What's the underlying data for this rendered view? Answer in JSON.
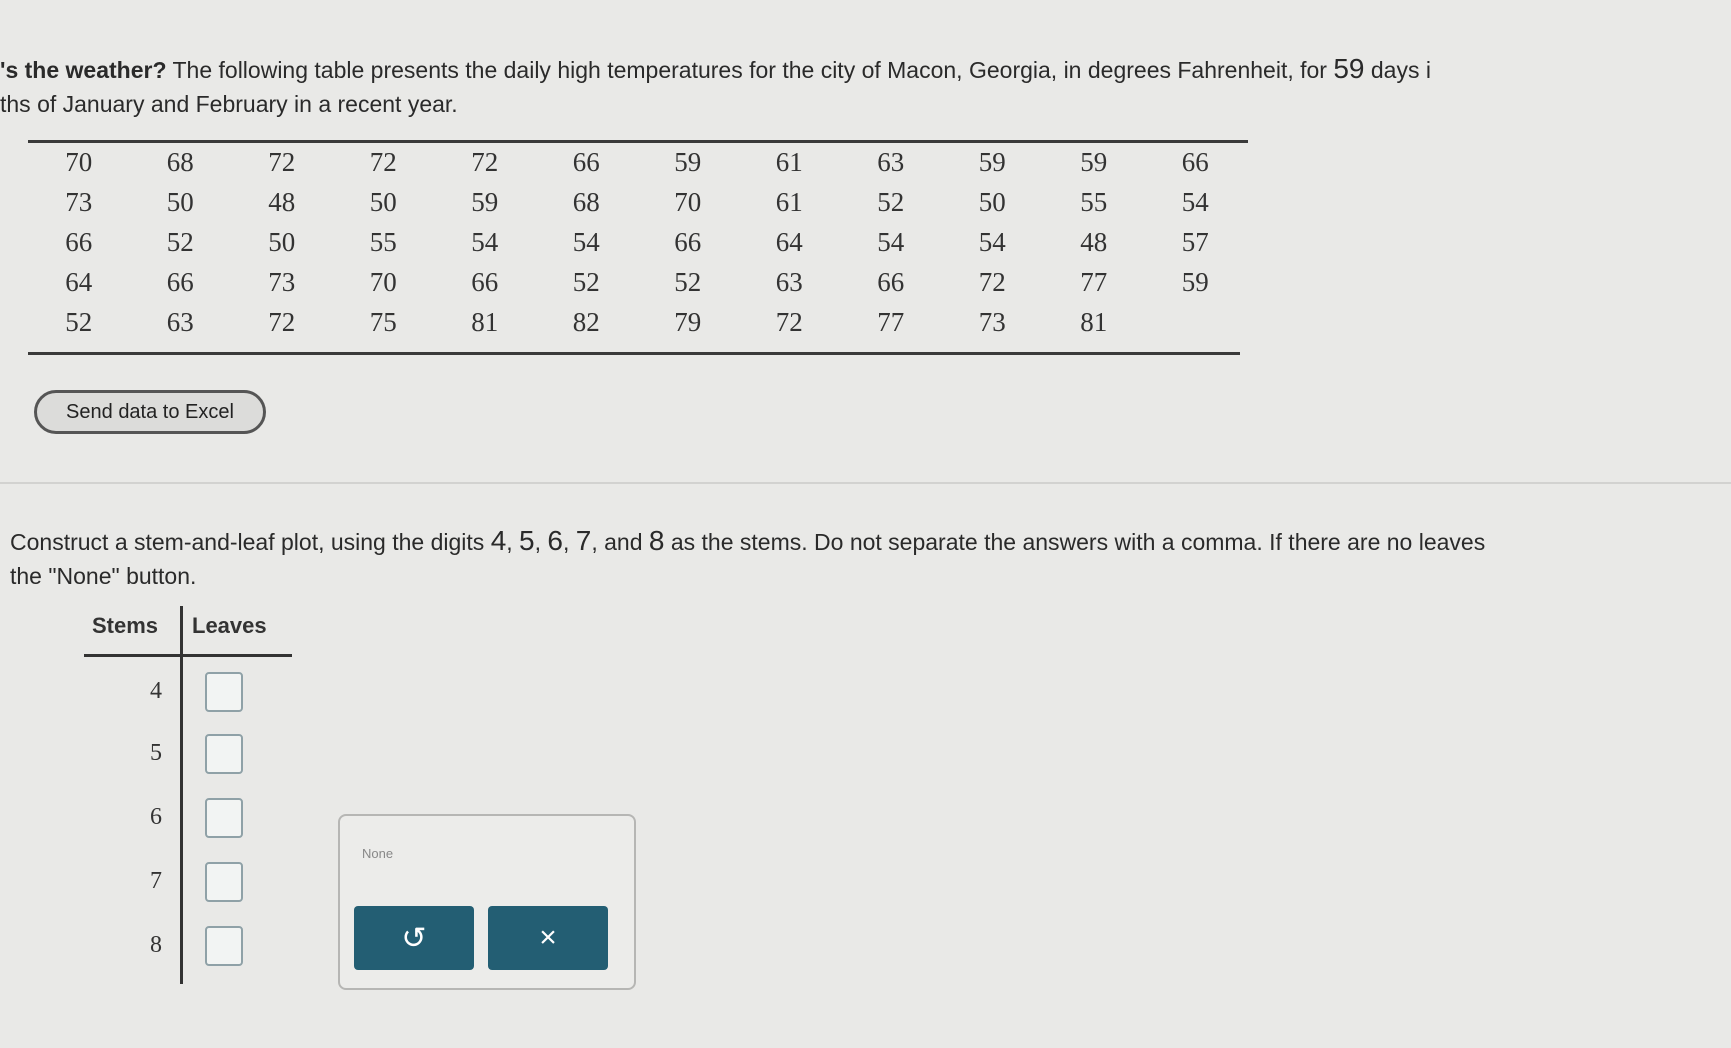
{
  "intro": {
    "part1": "'s the weather?",
    "part2": " The following table presents the daily high temperatures for the city of Macon, Georgia, in degrees Fahrenheit, for ",
    "days_count": "59",
    "part3": " days i",
    "line2": "ths of January and February in a recent year."
  },
  "temperatures": [
    [
      "70",
      "68",
      "72",
      "72",
      "72",
      "66",
      "59",
      "61",
      "63",
      "59",
      "59",
      "66"
    ],
    [
      "73",
      "50",
      "48",
      "50",
      "59",
      "68",
      "70",
      "61",
      "52",
      "50",
      "55",
      "54"
    ],
    [
      "66",
      "52",
      "50",
      "55",
      "54",
      "54",
      "66",
      "64",
      "54",
      "54",
      "48",
      "57"
    ],
    [
      "64",
      "66",
      "73",
      "70",
      "66",
      "52",
      "52",
      "63",
      "66",
      "72",
      "77",
      "59"
    ],
    [
      "52",
      "63",
      "72",
      "75",
      "81",
      "82",
      "79",
      "72",
      "77",
      "73",
      "81",
      ""
    ]
  ],
  "excel_button": "Send data to Excel",
  "instructions": {
    "part1": "Construct a stem-and-leaf plot, using the digits ",
    "d4": "4",
    "sep1": ", ",
    "d5": "5",
    "sep2": ", ",
    "d6": "6",
    "sep3": ",  ",
    "d7": "7",
    "sep4": ", and ",
    "d8": "8",
    "part2": " as the stems. Do not separate the answers with a comma. If there are no leaves",
    "line2": "the \"None\" button."
  },
  "stem_leaf": {
    "stems_header": "Stems",
    "leaves_header": "Leaves",
    "stems": [
      "4",
      "5",
      "6",
      "7",
      "8"
    ]
  },
  "panel": {
    "none_label": "None",
    "undo_icon": "↺",
    "clear_icon": "×"
  }
}
